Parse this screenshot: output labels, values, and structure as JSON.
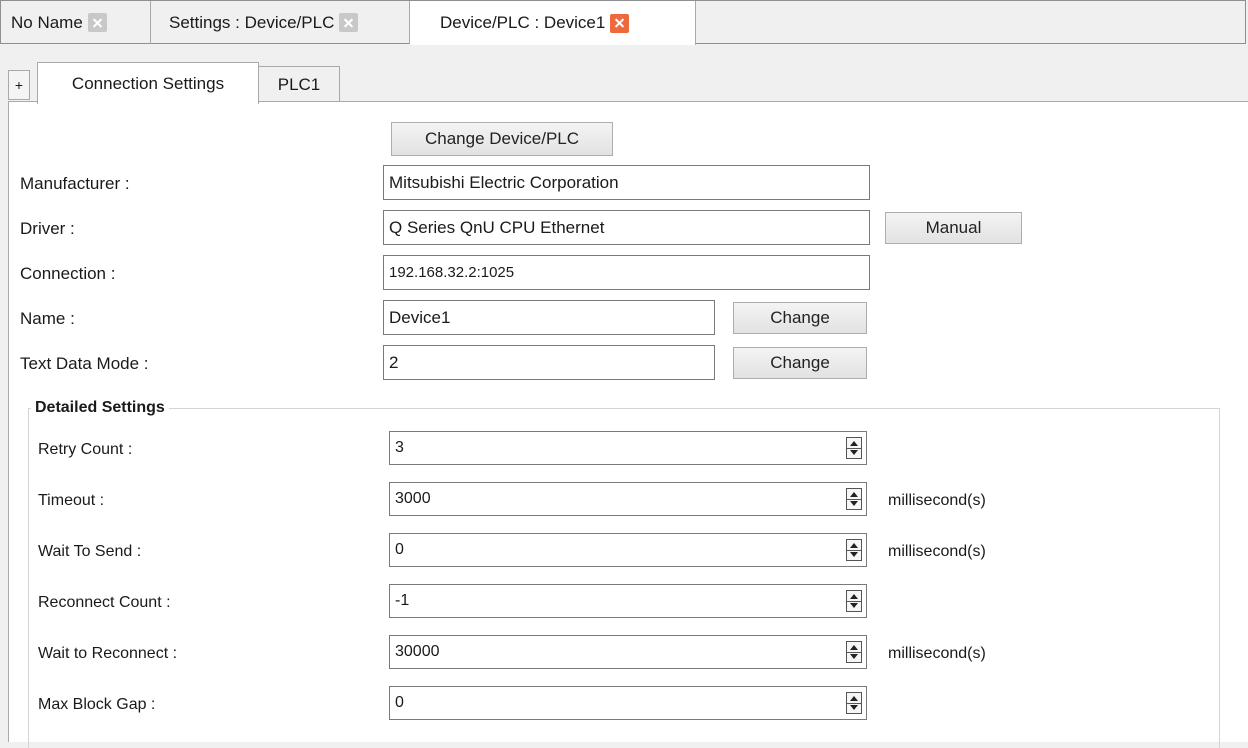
{
  "doc_tabs": [
    {
      "label": "No Name",
      "active": false
    },
    {
      "label": "Settings : Device/PLC",
      "active": false
    },
    {
      "label": "Device/PLC : Device1",
      "active": true
    }
  ],
  "sub_tabs": {
    "add_label": "+",
    "items": [
      {
        "label": "Connection Settings",
        "active": true
      },
      {
        "label": "PLC1",
        "active": false
      }
    ]
  },
  "form": {
    "change_device_label": "Change Device/PLC",
    "manufacturer_label": "Manufacturer :",
    "manufacturer_value": "Mitsubishi Electric Corporation",
    "driver_label": "Driver :",
    "driver_value": "Q Series QnU CPU Ethernet",
    "manual_label": "Manual",
    "connection_label": "Connection :",
    "connection_value": "192.168.32.2:1025",
    "name_label": "Name :",
    "name_value": "Device1",
    "name_change_label": "Change",
    "text_mode_label": "Text Data Mode :",
    "text_mode_value": "2",
    "text_mode_change_label": "Change"
  },
  "detailed": {
    "title": "Detailed Settings",
    "rows": [
      {
        "label": "Retry Count :",
        "value": "3",
        "unit": ""
      },
      {
        "label": "Timeout :",
        "value": "3000",
        "unit": "millisecond(s)"
      },
      {
        "label": "Wait To Send :",
        "value": "0",
        "unit": "millisecond(s)"
      },
      {
        "label": "Reconnect Count :",
        "value": "-1",
        "unit": ""
      },
      {
        "label": "Wait to Reconnect :",
        "value": "30000",
        "unit": "millisecond(s)"
      },
      {
        "label": "Max Block Gap :",
        "value": "0",
        "unit": ""
      }
    ]
  },
  "colors": {
    "active_close": "#ee6a3c",
    "inactive_close": "#c8c8c8"
  },
  "icons": {
    "close": "close-icon",
    "spin": "spinner-arrows-icon"
  }
}
